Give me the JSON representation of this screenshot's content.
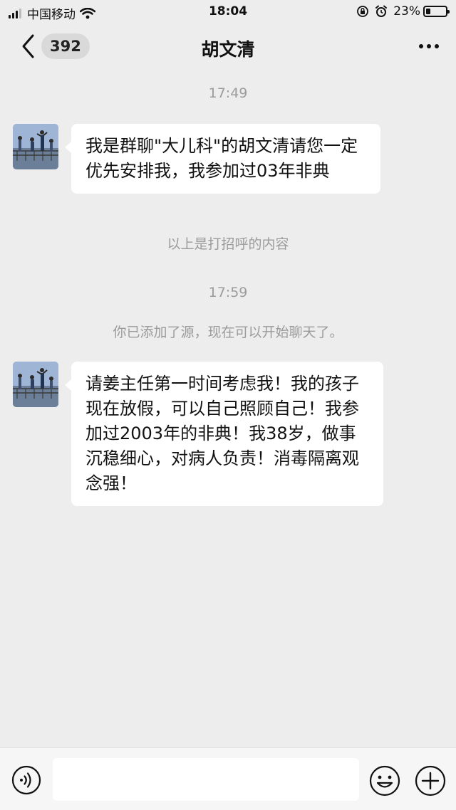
{
  "status_bar": {
    "carrier": "中国移动",
    "time": "18:04",
    "battery_percent": "23%",
    "battery_level": 0.23,
    "icons": [
      "signal-icon",
      "wifi-icon",
      "orientation-lock-icon",
      "alarm-icon",
      "battery-icon"
    ]
  },
  "nav": {
    "back_icon": "chevron-left-icon",
    "unread_count": "392",
    "title": "胡文清",
    "more_icon": "more-dots-icon"
  },
  "chat": {
    "timestamp_1": "17:49",
    "message_1": "我是群聊\"大儿科\"的胡文清请您一定优先安排我，我参加过03年非典",
    "system_note_1": "以上是打招呼的内容",
    "timestamp_2": "17:59",
    "system_note_2": "你已添加了源，现在可以开始聊天了。",
    "message_2": "请姜主任第一时间考虑我！我的孩子现在放假，可以自己照顾自己！我参加过2003年的非典！我38岁，做事沉稳细心，对病人负责！消毒隔离观念强！"
  },
  "input_bar": {
    "voice_icon": "voice-icon",
    "input_value": "",
    "emoji_icon": "emoji-icon",
    "plus_icon": "plus-icon"
  },
  "colors": {
    "background": "#ededed",
    "bubble": "#ffffff",
    "system_text": "#9b9b9b"
  }
}
